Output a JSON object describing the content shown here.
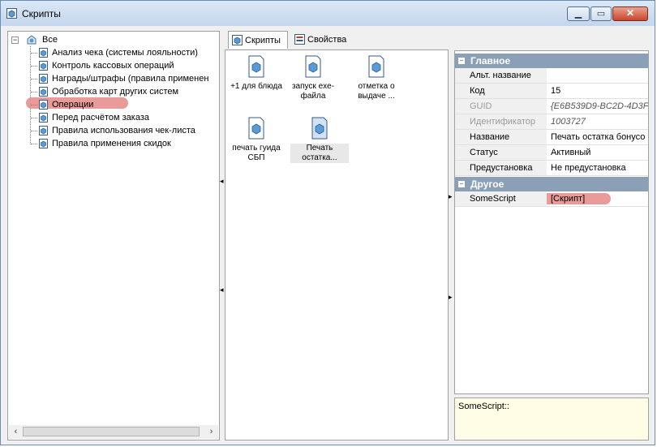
{
  "window": {
    "title": "Скрипты"
  },
  "tree": {
    "root": "Все",
    "items": [
      "Анализ чека (системы лояльности)",
      "Контроль кассовых операций",
      "Награды/штрафы (правила применен",
      "Обработка карт других систем",
      "Операции",
      "Перед расчётом заказа",
      "Правила использования чек-листа",
      "Правила применения скидок"
    ],
    "selected_index": 4
  },
  "tabs": [
    {
      "label": "Скрипты",
      "active": true
    },
    {
      "label": "Свойства",
      "active": false
    }
  ],
  "scripts": [
    {
      "label": "+1 для блюда"
    },
    {
      "label": "запуск exe-файла"
    },
    {
      "label": "отметка о выдаче ..."
    },
    {
      "label": "печать гуида СБП"
    },
    {
      "label": "Печать остатка..."
    }
  ],
  "properties": {
    "main_category": "Главное",
    "main": [
      {
        "name": "Альт. название",
        "value": ""
      },
      {
        "name": "Код",
        "value": "15"
      },
      {
        "name": "GUID",
        "value": "{E6B539D9-BC2D-4D3F"
      },
      {
        "name": "Идентификатор",
        "value": "1003727"
      },
      {
        "name": "Название",
        "value": "Печать остатка бонусо"
      },
      {
        "name": "Статус",
        "value": "Активный"
      },
      {
        "name": "Предустановка",
        "value": "Не предустановка"
      }
    ],
    "other_category": "Другое",
    "other": [
      {
        "name": "SomeScript",
        "value": "[Скрипт]"
      }
    ]
  },
  "description": {
    "text": "SomeScript::"
  },
  "colors": {
    "highlight": "#e48a86",
    "category": "#8ba0b6",
    "desc_bg": "#fffde6"
  }
}
